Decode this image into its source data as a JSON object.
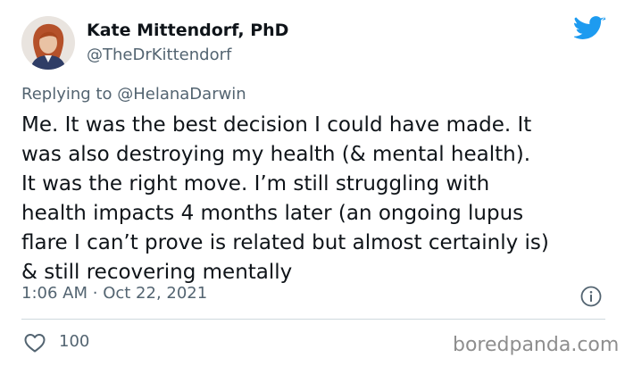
{
  "author": {
    "name": "Kate Mittendorf, PhD",
    "handle": "@TheDrKittendorf"
  },
  "reply": {
    "prefix": "Replying to",
    "mention": "@HelanaDarwin"
  },
  "tweet": {
    "lines": [
      "Me. It was the best decision I could have made. It",
      "was also destroying my health (& mental health).",
      "It was the right move. I’m still struggling with",
      "health impacts 4 months later (an ongoing lupus",
      "flare I can’t prove is related but almost certainly is)",
      "& still recovering mentally"
    ]
  },
  "meta": {
    "time": "1:06 AM",
    "separator": "·",
    "date": "Oct 22, 2021"
  },
  "engagement": {
    "likes": "100"
  },
  "watermark": "boredpanda.com",
  "icons": {
    "bird": "twitter-bird-icon",
    "info": "info-icon",
    "heart": "heart-icon"
  },
  "colors": {
    "brand": "#1d9bf0",
    "text": "#0f1419",
    "muted": "#536471",
    "divider": "#cfd9de"
  }
}
